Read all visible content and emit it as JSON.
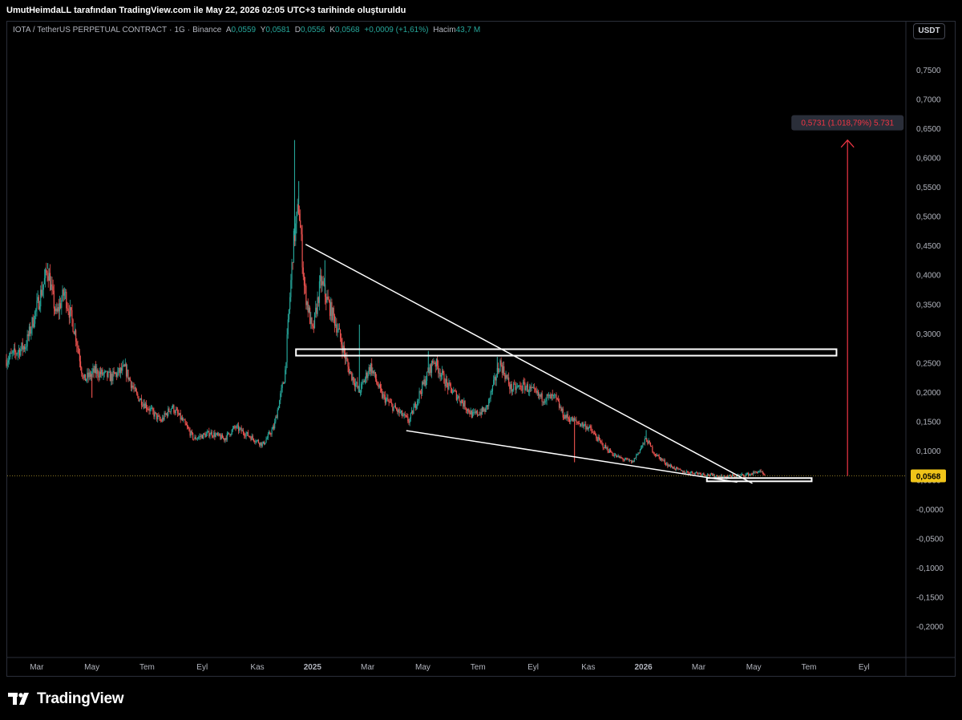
{
  "attribution": "UmutHeimdaLL tarafından TradingView.com ile May 22, 2026 02:05 UTC+3 tarihinde oluşturuldu",
  "legend": {
    "symbol": "IOTA / TetherUS PERPETUAL CONTRACT",
    "interval": "1G",
    "exchange": "Binance",
    "open_label": "A",
    "open": "0,0559",
    "high_label": "Y",
    "high": "0,0581",
    "low_label": "D",
    "low": "0,0556",
    "close_label": "K",
    "close": "0,0568",
    "change": "+0,0009 (+1,61%)",
    "volume_label": "Hacim",
    "volume": "43,7 M"
  },
  "currency_button": "USDT",
  "brand": "TradingView",
  "colors": {
    "up": "#26a69a",
    "down": "#ef5350",
    "last_price_bg": "#f0c419",
    "measure_arrow": "#f23645",
    "drawing_lines": "#ffffff"
  },
  "chart_data": {
    "type": "candlestick",
    "title": "",
    "y_axis": {
      "ylim": [
        -0.22,
        0.79
      ],
      "ticks": [
        "0,7500",
        "0,7000",
        "0,6500",
        "0,6000",
        "0,5500",
        "0,5000",
        "0,4500",
        "0,4000",
        "0,3500",
        "0,3000",
        "0,2500",
        "0,2000",
        "0,1500",
        "0,1000",
        "0,0500",
        "-0,0000",
        "-0,0500",
        "-0,1000",
        "-0,1500",
        "-0,2000"
      ]
    },
    "x_axis": {
      "labels": [
        {
          "t": "Mar",
          "bold": false
        },
        {
          "t": "May",
          "bold": false
        },
        {
          "t": "Tem",
          "bold": false
        },
        {
          "t": "Eyl",
          "bold": false
        },
        {
          "t": "Kas",
          "bold": false
        },
        {
          "t": "2025",
          "bold": true
        },
        {
          "t": "Mar",
          "bold": false
        },
        {
          "t": "May",
          "bold": false
        },
        {
          "t": "Tem",
          "bold": false
        },
        {
          "t": "Eyl",
          "bold": false
        },
        {
          "t": "Kas",
          "bold": false
        },
        {
          "t": "2026",
          "bold": true
        },
        {
          "t": "Mar",
          "bold": false
        },
        {
          "t": "May",
          "bold": false
        },
        {
          "t": "Tem",
          "bold": false
        },
        {
          "t": "Eyl",
          "bold": false
        }
      ],
      "months_from_start": [
        1.1,
        3.1,
        5.1,
        7.1,
        9.1,
        11.1,
        13.1,
        15.1,
        17.1,
        19.1,
        21.1,
        23.1,
        25.1,
        27.1,
        29.1,
        31.1
      ]
    },
    "price_path": [
      [
        0.0,
        0.255
      ],
      [
        0.7,
        0.28
      ],
      [
        1.2,
        0.36
      ],
      [
        1.5,
        0.41
      ],
      [
        1.8,
        0.33
      ],
      [
        2.1,
        0.37
      ],
      [
        2.5,
        0.3
      ],
      [
        2.8,
        0.22
      ],
      [
        3.2,
        0.235
      ],
      [
        3.8,
        0.225
      ],
      [
        4.3,
        0.24
      ],
      [
        4.7,
        0.195
      ],
      [
        5.2,
        0.17
      ],
      [
        5.6,
        0.15
      ],
      [
        6.0,
        0.175
      ],
      [
        6.4,
        0.15
      ],
      [
        6.8,
        0.12
      ],
      [
        7.4,
        0.13
      ],
      [
        7.9,
        0.12
      ],
      [
        8.3,
        0.14
      ],
      [
        8.8,
        0.125
      ],
      [
        9.3,
        0.11
      ],
      [
        9.7,
        0.14
      ],
      [
        10.1,
        0.23
      ],
      [
        10.4,
        0.45
      ],
      [
        10.6,
        0.52
      ],
      [
        10.8,
        0.38
      ],
      [
        11.1,
        0.3
      ],
      [
        11.4,
        0.39
      ],
      [
        11.6,
        0.36
      ],
      [
        12.0,
        0.31
      ],
      [
        12.4,
        0.24
      ],
      [
        12.8,
        0.2
      ],
      [
        13.2,
        0.245
      ],
      [
        13.6,
        0.195
      ],
      [
        14.0,
        0.175
      ],
      [
        14.6,
        0.15
      ],
      [
        15.0,
        0.2
      ],
      [
        15.5,
        0.255
      ],
      [
        16.0,
        0.21
      ],
      [
        16.4,
        0.19
      ],
      [
        16.9,
        0.16
      ],
      [
        17.4,
        0.17
      ],
      [
        17.9,
        0.25
      ],
      [
        18.3,
        0.205
      ],
      [
        18.8,
        0.21
      ],
      [
        19.4,
        0.19
      ],
      [
        19.9,
        0.19
      ],
      [
        20.2,
        0.16
      ],
      [
        20.6,
        0.15
      ],
      [
        21.1,
        0.14
      ],
      [
        21.6,
        0.11
      ],
      [
        22.1,
        0.09
      ],
      [
        22.7,
        0.08
      ],
      [
        23.2,
        0.12
      ],
      [
        23.5,
        0.095
      ],
      [
        24.0,
        0.075
      ],
      [
        24.5,
        0.064
      ],
      [
        25.0,
        0.062
      ],
      [
        25.5,
        0.058
      ],
      [
        26.0,
        0.055
      ],
      [
        26.5,
        0.057
      ],
      [
        27.0,
        0.06
      ],
      [
        27.3,
        0.065
      ],
      [
        27.5,
        0.0568
      ]
    ],
    "wick_highs": [
      {
        "m": 1.5,
        "v": 0.42
      },
      {
        "m": 10.45,
        "v": 0.63
      },
      {
        "m": 10.6,
        "v": 0.56
      },
      {
        "m": 11.55,
        "v": 0.425
      },
      {
        "m": 12.8,
        "v": 0.315
      },
      {
        "m": 15.3,
        "v": 0.27
      },
      {
        "m": 17.8,
        "v": 0.26
      },
      {
        "m": 23.2,
        "v": 0.135
      }
    ],
    "wick_lows": [
      {
        "m": 20.6,
        "v": 0.08
      },
      {
        "m": 3.1,
        "v": 0.19
      }
    ],
    "last_price": "0,0568",
    "last_price_value": 0.0568,
    "drawings": {
      "resistance_zone": {
        "from_m": 10.5,
        "to_m": 30.1,
        "lo": 0.262,
        "hi": 0.273
      },
      "base_zone": {
        "from_m": 25.4,
        "to_m": 29.2,
        "lo": 0.0475,
        "hi": 0.053
      },
      "upper_trendline": {
        "m1": 10.85,
        "v1": 0.452,
        "m2": 27.05,
        "v2": 0.044
      },
      "lower_trendline": {
        "m1": 14.5,
        "v1": 0.134,
        "m2": 26.5,
        "v2": 0.046
      },
      "measure": {
        "m": 30.5,
        "from": 0.0568,
        "to": 0.63,
        "label": "0,5731 (1.018,79%) 5.731"
      }
    }
  }
}
